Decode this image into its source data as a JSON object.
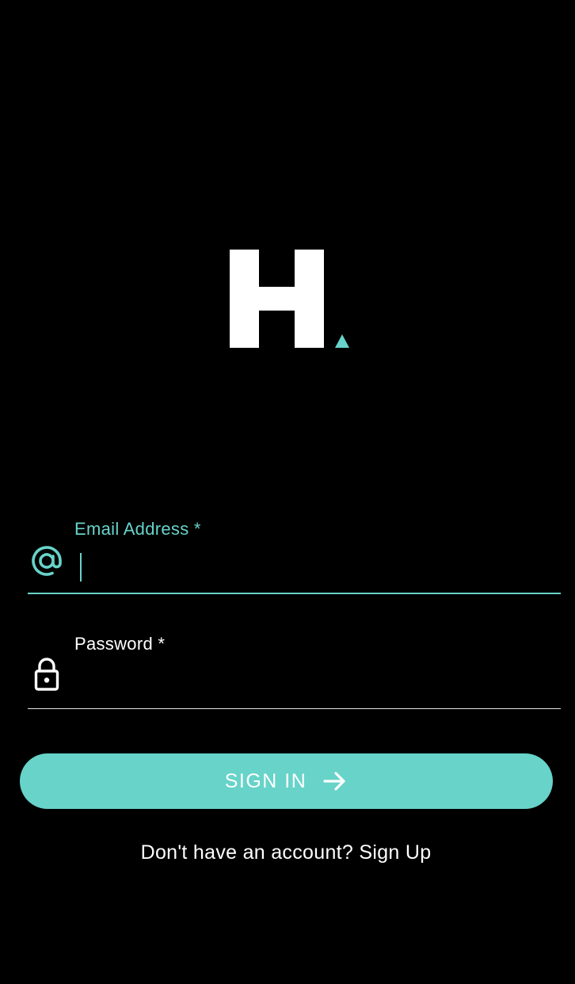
{
  "logo": {
    "letter": "H",
    "mark_color": "#67d3c9",
    "letter_color": "#ffffff"
  },
  "form": {
    "email": {
      "label": "Email Address *",
      "value": "",
      "icon": "at-icon"
    },
    "password": {
      "label": "Password *",
      "value": "",
      "icon": "lock-icon"
    }
  },
  "signin": {
    "label": "SIGN IN",
    "icon": "arrow-right-icon"
  },
  "signup": {
    "prompt": "Don't have an account?",
    "link": "Sign Up"
  },
  "colors": {
    "accent": "#67d3c9",
    "background": "#000000",
    "text": "#ffffff"
  }
}
